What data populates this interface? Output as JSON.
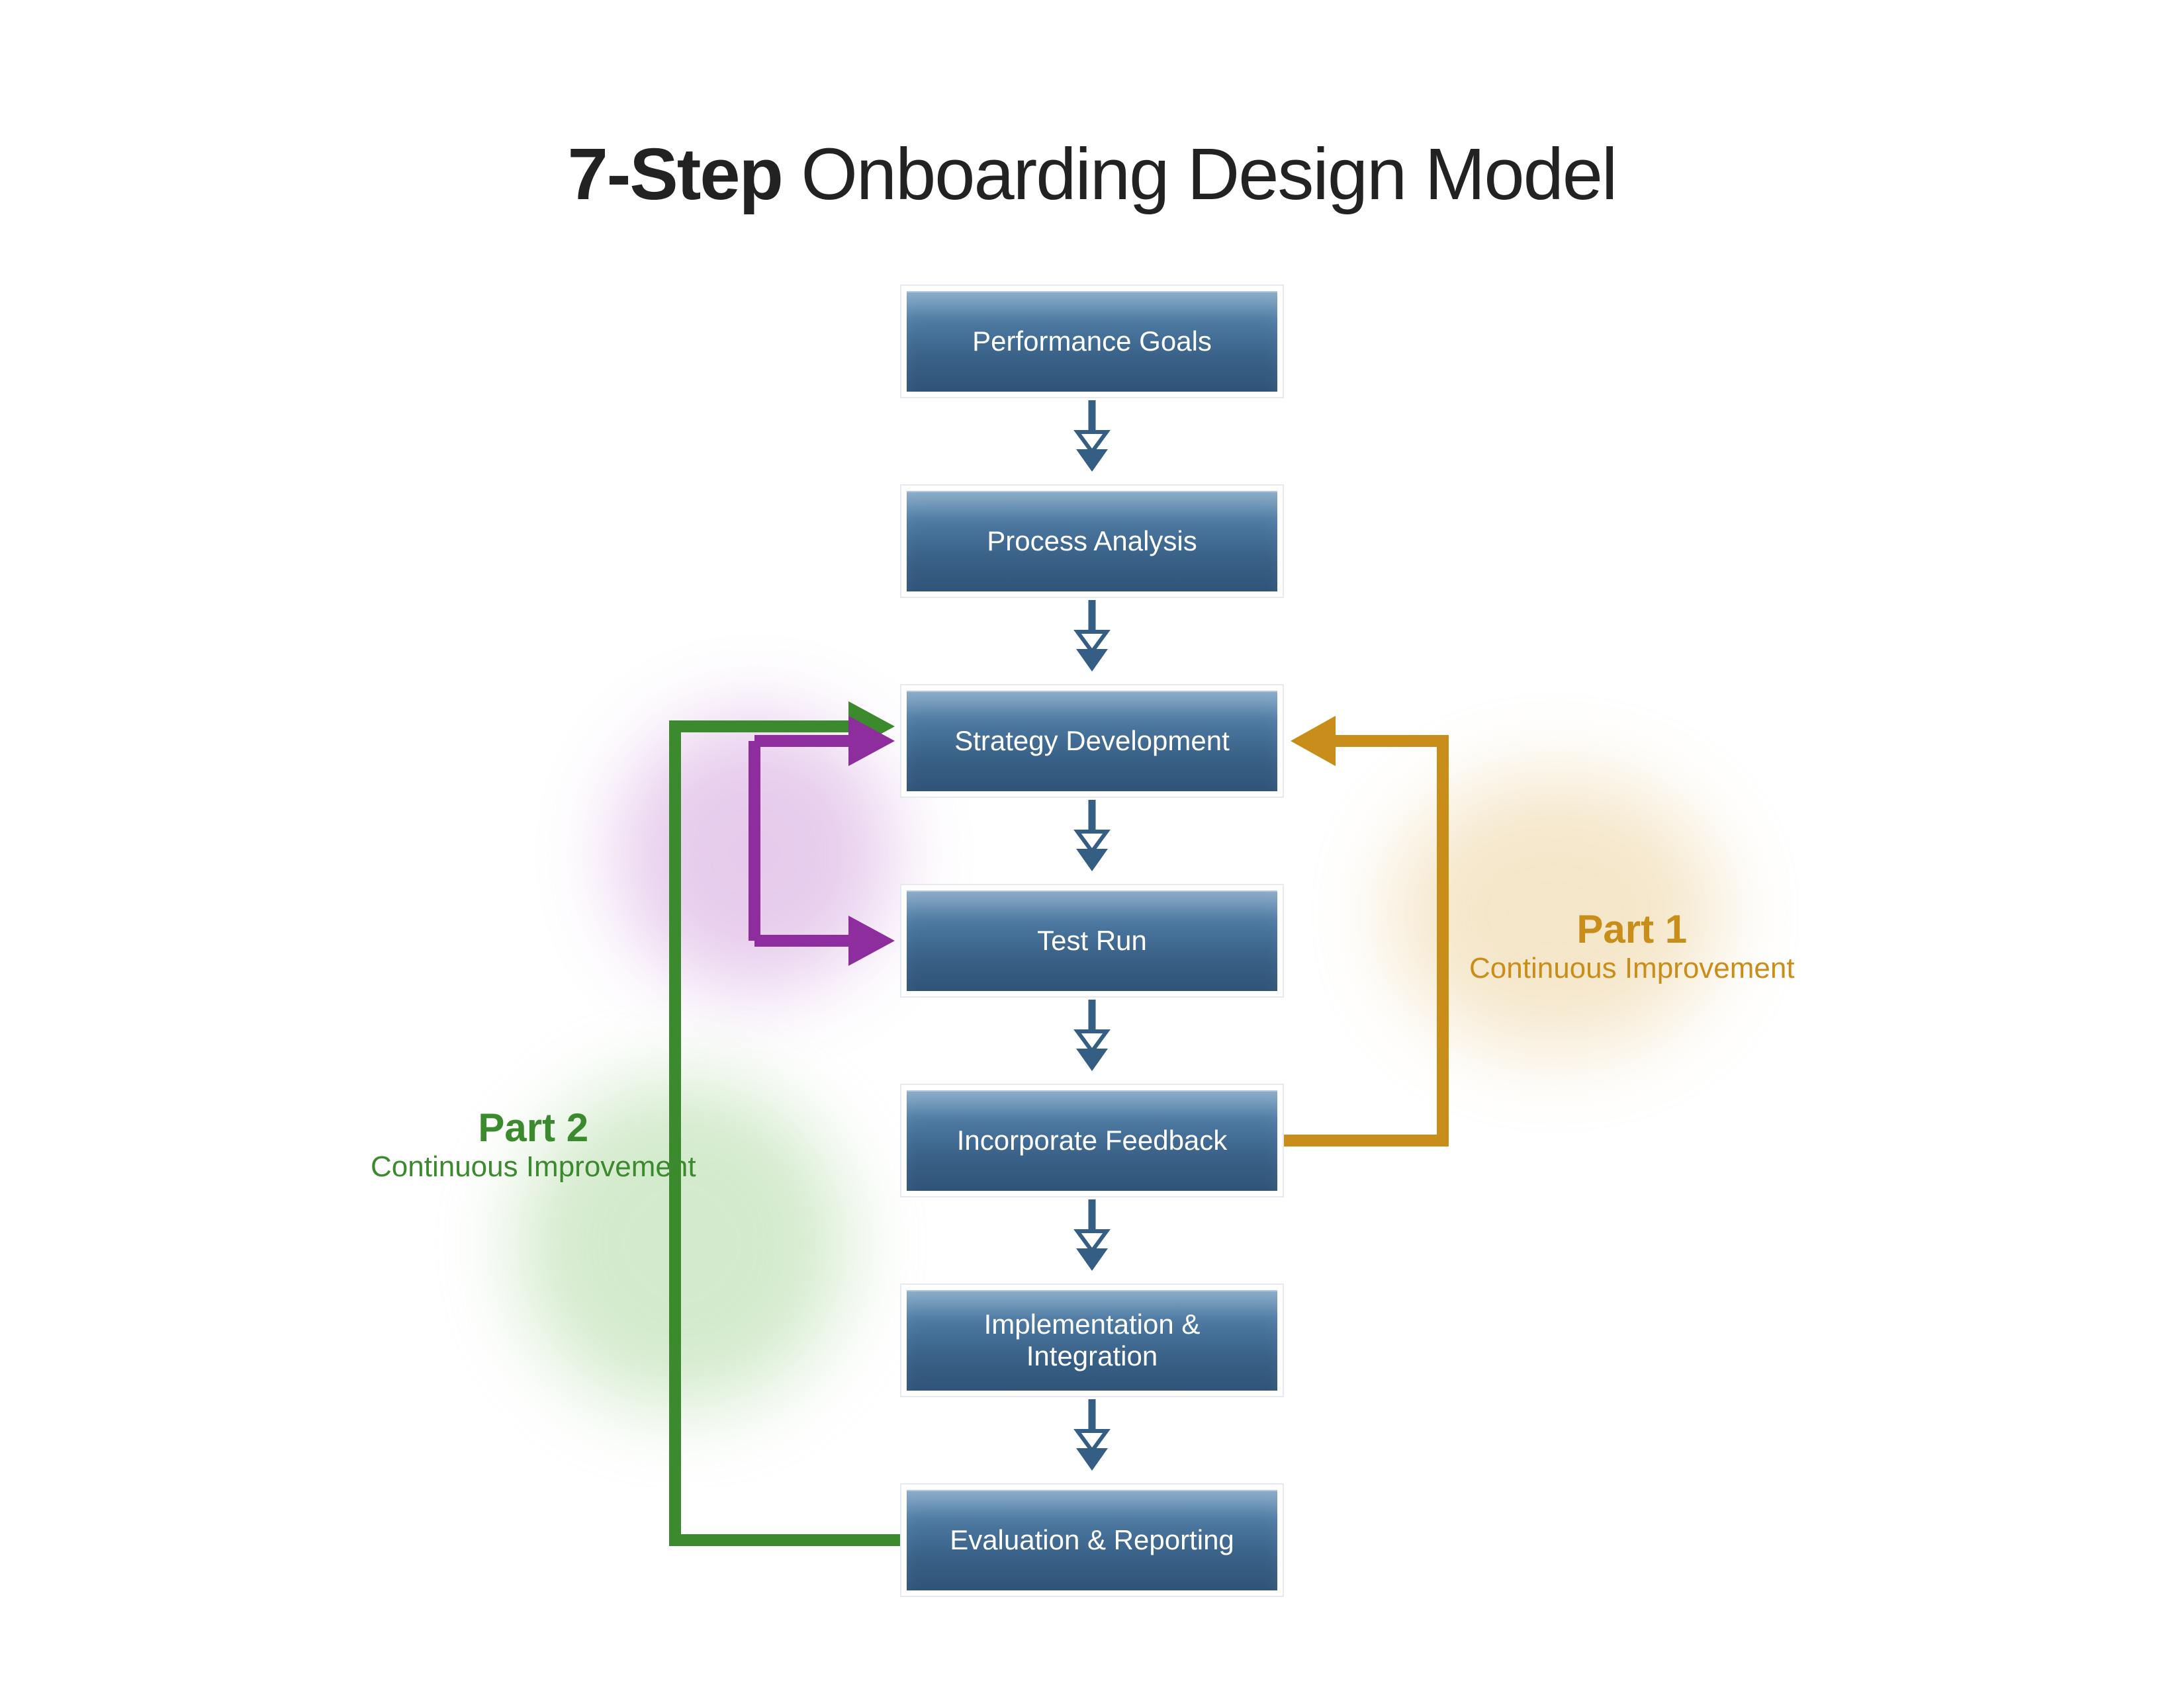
{
  "title": {
    "bold": "7-Step",
    "rest": " Onboarding Design Model"
  },
  "steps": [
    "Performance Goals",
    "Process Analysis",
    "Strategy Development",
    "Test Run",
    "Incorporate Feedback",
    "Implementation & Integration",
    "Evaluation & Reporting"
  ],
  "loops": {
    "part1": {
      "title": "Part 1",
      "subtitle": "Continuous Improvement",
      "color": "#c98e1a"
    },
    "part2": {
      "title": "Part 2",
      "subtitle": "Continuous Improvement",
      "color": "#3b8a2d"
    },
    "purple_color": "#8e2d9e"
  },
  "colors": {
    "box_gradient_top": "#6f98bb",
    "box_gradient_bottom": "#2f5478",
    "arrow_blue": "#355e85"
  }
}
